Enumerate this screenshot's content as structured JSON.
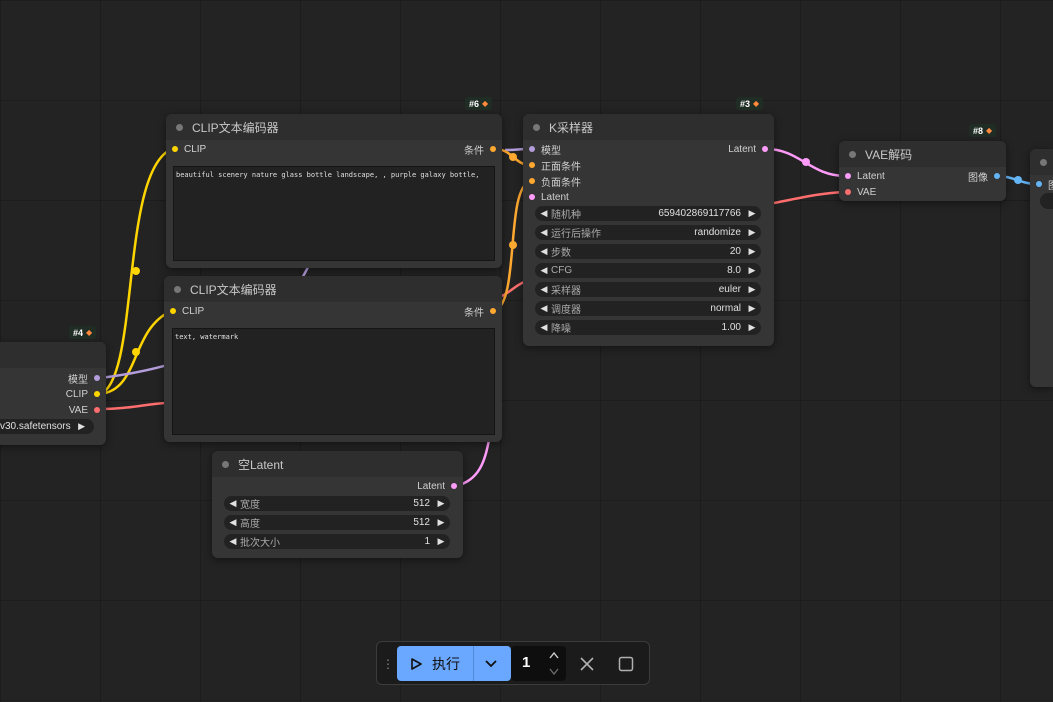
{
  "nodes": {
    "clip_encoder_positive": {
      "badge_id": "#6",
      "title": "CLIP文本编码器",
      "input_clip": "CLIP",
      "output_condition": "条件",
      "text": "beautiful scenery nature glass bottle landscape, , purple galaxy bottle,"
    },
    "clip_encoder_negative": {
      "title": "CLIP文本编码器",
      "input_clip": "CLIP",
      "output_condition": "条件",
      "text": "text, watermark"
    },
    "ksampler": {
      "badge_id": "#3",
      "title": "K采样器",
      "inputs": [
        "模型",
        "正面条件",
        "负面条件",
        "Latent"
      ],
      "output_latent": "Latent",
      "widgets": [
        {
          "label": "随机种",
          "value": "659402869117766"
        },
        {
          "label": "运行后操作",
          "value": "randomize"
        },
        {
          "label": "步数",
          "value": "20"
        },
        {
          "label": "CFG",
          "value": "8.0"
        },
        {
          "label": "采样器",
          "value": "euler"
        },
        {
          "label": "调度器",
          "value": "normal"
        },
        {
          "label": "降噪",
          "value": "1.00"
        }
      ]
    },
    "vae_decode": {
      "badge_id": "#8",
      "title": "VAE解码",
      "input_latent": "Latent",
      "input_vae": "VAE",
      "output_image": "图像"
    },
    "checkpoint_loader": {
      "badge_id": "#4",
      "outputs": [
        "模型",
        "CLIP",
        "VAE"
      ],
      "ckpt_name": "v30.safetensors"
    },
    "empty_latent": {
      "title": "空Latent",
      "output_latent": "Latent",
      "widgets": [
        {
          "label": "宽度",
          "value": "512"
        },
        {
          "label": "高度",
          "value": "512"
        },
        {
          "label": "批次大小",
          "value": "1"
        }
      ]
    },
    "save_image": {
      "output_partial": "图"
    }
  },
  "toolbar": {
    "run_label": "执行",
    "batch_count": "1",
    "icons": [
      "drag-handle-icon",
      "play-icon",
      "chevron-down-icon",
      "chevron-up-icon",
      "close-icon",
      "stop-icon"
    ]
  },
  "colors": {
    "canvas": "#232323",
    "node_body": "#353535",
    "node_title": "#2e2e2e",
    "clip": "#ffd500",
    "model": "#b39ddb",
    "vae": "#ff6e6e",
    "conditioning": "#ffa931",
    "latent": "#ff9cf9",
    "image": "#64b5f6",
    "badge_bg": "#1f2d24",
    "run_button": "#6aa8ff"
  }
}
